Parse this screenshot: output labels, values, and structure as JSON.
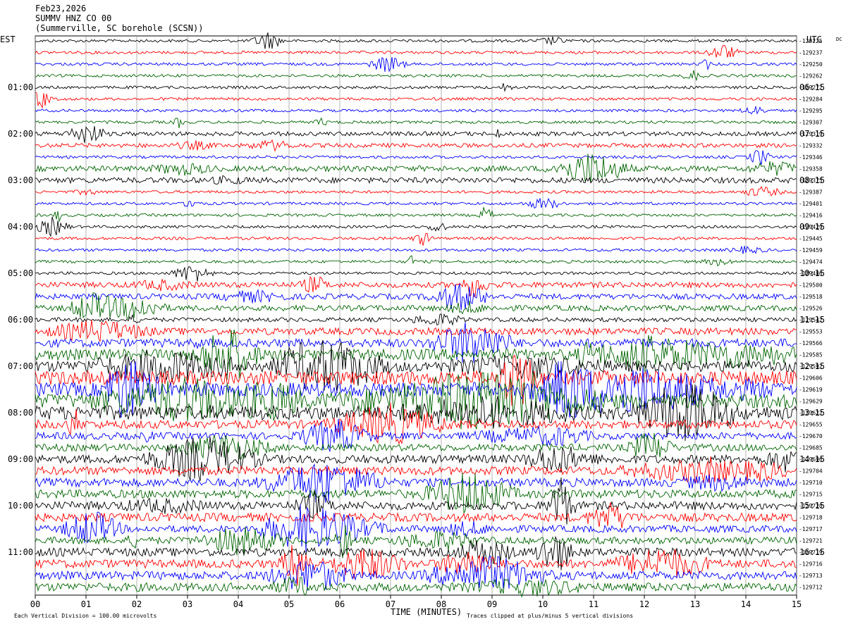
{
  "header": {
    "date": "Feb23,2026",
    "station": "SUMMV HNZ CO 00",
    "location": "(Summerville, SC borehole (SCSN))"
  },
  "axes": {
    "left_zone": "EST",
    "right_zone": "UTC",
    "dc_label": "DC",
    "xlabel": "TIME (MINUTES)",
    "scale_note": "Each Vertical Division = 100.00 microvolts",
    "clip_note": "Traces clipped at plus/minus 5 vertical divisions"
  },
  "colors": {
    "trace_cycle": [
      "#000000",
      "#ff0000",
      "#0000ff",
      "#006400"
    ],
    "grid": "#808080"
  },
  "chart_data": {
    "type": "line",
    "title": "SUMMV HNZ CO 00",
    "xlabel": "TIME (MINUTES)",
    "xlim": [
      0,
      15
    ],
    "x_ticks": [
      "00",
      "01",
      "02",
      "03",
      "04",
      "05",
      "06",
      "07",
      "08",
      "09",
      "10",
      "11",
      "12",
      "13",
      "14",
      "15"
    ],
    "left_hour_labels": [
      "01:00",
      "02:00",
      "03:00",
      "04:00",
      "05:00",
      "06:00",
      "07:00",
      "08:00",
      "09:00",
      "10:00",
      "11:00"
    ],
    "right_hour_labels": [
      "06:15",
      "07:15",
      "08:15",
      "09:15",
      "10:15",
      "11:15",
      "12:15",
      "13:15",
      "14:15",
      "15:15",
      "16:15"
    ],
    "trace_offsets": [
      -129225,
      -129237,
      -129250,
      -129262,
      -129272,
      -129284,
      -129295,
      -129307,
      -129319,
      -129332,
      -129346,
      -129358,
      -129375,
      -129387,
      -129401,
      -129416,
      -129429,
      -129445,
      -129459,
      -129474,
      -129486,
      -129500,
      -129518,
      -129526,
      -129542,
      -129553,
      -129566,
      -129585,
      -129592,
      -129606,
      -129619,
      -129629,
      -129622,
      -129655,
      -129670,
      -129685,
      -129696,
      -129704,
      -129710,
      -129715,
      -129720,
      -129718,
      -129717,
      -129721,
      -129719,
      -129716,
      -129713,
      -129712
    ],
    "trace_activity": [
      1,
      1,
      1,
      1,
      1,
      1,
      1,
      1,
      1.5,
      1.5,
      1,
      2,
      2,
      1,
      1,
      1,
      1,
      1,
      1,
      1,
      1,
      2,
      2,
      2,
      1.5,
      2.5,
      3,
      4,
      4,
      5,
      5,
      5,
      5,
      3,
      2.5,
      2.5,
      3,
      3,
      3,
      3,
      3,
      3,
      2.5,
      2.5,
      3,
      3,
      3,
      3
    ],
    "grid": true
  }
}
